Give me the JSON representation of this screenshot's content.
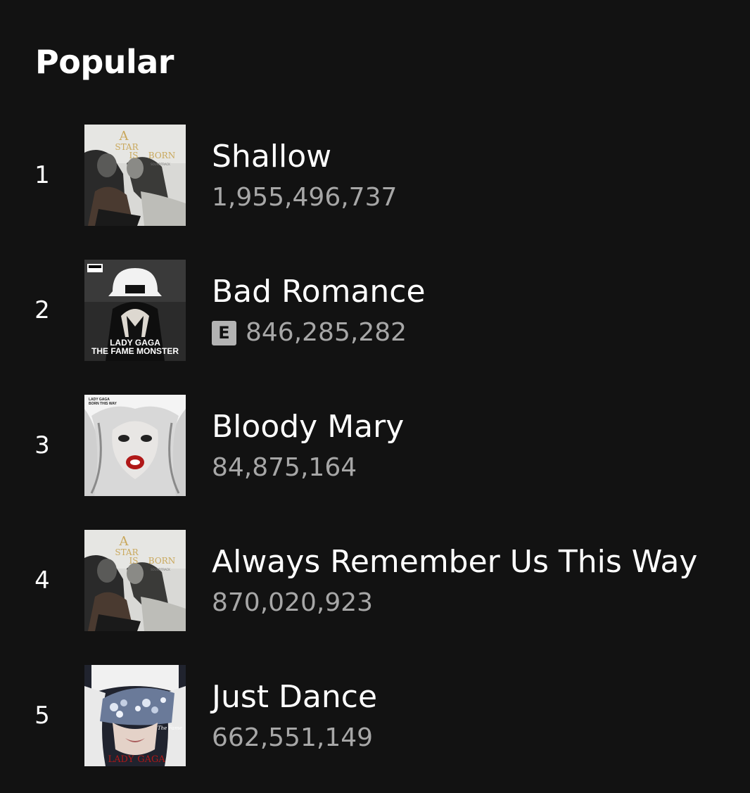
{
  "section": {
    "title": "Popular"
  },
  "tracks": [
    {
      "index": "1",
      "title": "Shallow",
      "plays": "1,955,496,737",
      "explicit": false,
      "cover_text": [
        "A",
        "STAR",
        "IS",
        "BORN",
        "SOUNDTRACK"
      ]
    },
    {
      "index": "2",
      "title": "Bad Romance",
      "plays": "846,285,282",
      "explicit": true,
      "explicit_label": "E",
      "cover_text": [
        "LADY GAGA",
        "THE FAME MONSTER"
      ]
    },
    {
      "index": "3",
      "title": "Bloody Mary",
      "plays": "84,875,164",
      "explicit": false,
      "cover_text": [
        "LADY GAGA",
        "BORN THIS WAY"
      ]
    },
    {
      "index": "4",
      "title": "Always Remember Us This Way",
      "plays": "870,020,923",
      "explicit": false,
      "cover_text": [
        "A",
        "STAR",
        "IS",
        "BORN",
        "SOUNDTRACK"
      ]
    },
    {
      "index": "5",
      "title": "Just Dance",
      "plays": "662,551,149",
      "explicit": false,
      "cover_text": [
        "LADY",
        "GAGA",
        "The Fame"
      ]
    }
  ],
  "colors": {
    "background": "#121212",
    "primary_text": "#ffffff",
    "secondary_text": "#a7a7a7",
    "explicit_badge": "#b3b3b3"
  }
}
